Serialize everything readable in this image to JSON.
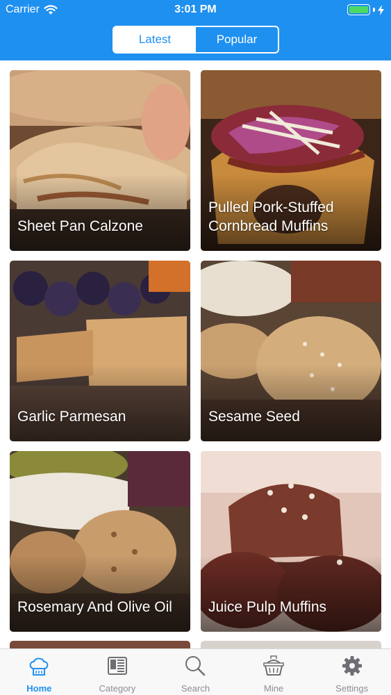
{
  "status_bar": {
    "carrier": "Carrier",
    "time": "3:01 PM"
  },
  "segments": [
    {
      "label": "Latest",
      "selected": true
    },
    {
      "label": "Popular",
      "selected": false
    }
  ],
  "recipes": [
    {
      "title": "Sheet Pan Calzone"
    },
    {
      "title": "Pulled Pork-Stuffed Cornbread Muffins"
    },
    {
      "title": "Garlic Parmesan"
    },
    {
      "title": "Sesame Seed"
    },
    {
      "title": "Rosemary And Olive Oil"
    },
    {
      "title": "Juice Pulp Muffins"
    }
  ],
  "tabs": [
    {
      "label": "Home",
      "icon": "chef-hat-icon",
      "active": true
    },
    {
      "label": "Category",
      "icon": "book-icon",
      "active": false
    },
    {
      "label": "Search",
      "icon": "search-icon",
      "active": false
    },
    {
      "label": "Mine",
      "icon": "basket-icon",
      "active": false
    },
    {
      "label": "Settings",
      "icon": "gear-icon",
      "active": false
    }
  ],
  "colors": {
    "accent": "#1e90f0",
    "tab_inactive": "#8e8e93",
    "battery": "#4cd964"
  }
}
